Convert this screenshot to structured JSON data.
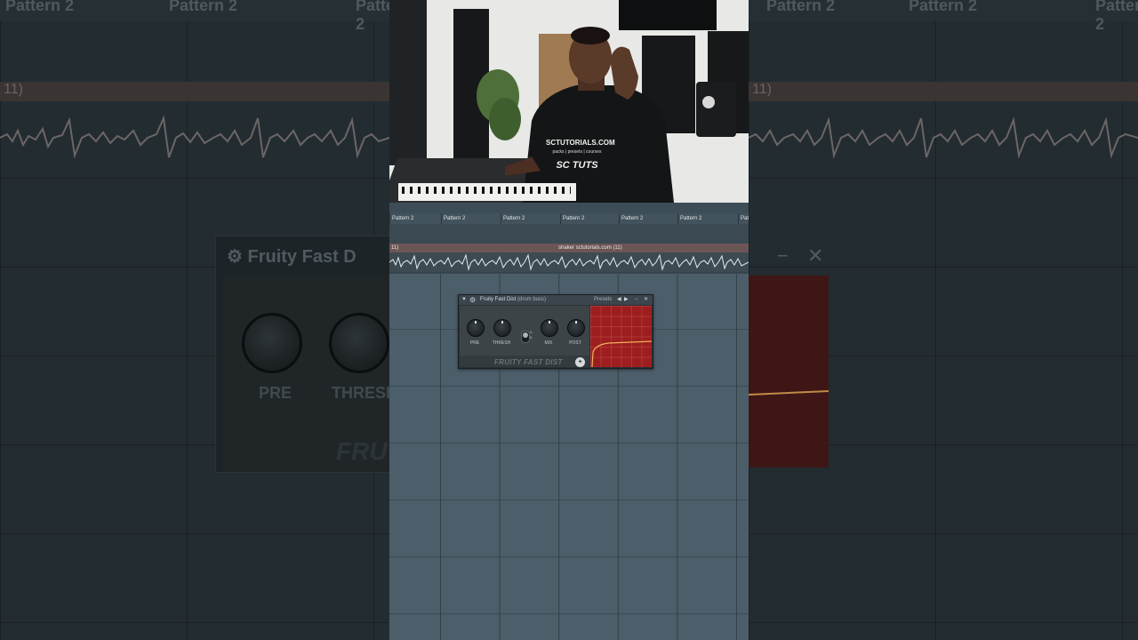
{
  "background": {
    "pattern_label": "Pattern 2",
    "clip_label_fragment": "11)",
    "plugin_title": "Fruity Fast D",
    "knob_labels": [
      "PRE",
      "THRESH"
    ],
    "brand_fragment": "FRU"
  },
  "video": {
    "shirt_line1": "SCTUTORIALS.COM",
    "shirt_line2": "packs | presets | courses",
    "shirt_line3": "SC TUTS"
  },
  "playlist": {
    "patterns": [
      "Pattern 2",
      "Pattern 2",
      "Pattern 2",
      "Pattern 2",
      "Pattern 2",
      "Pattern 2",
      "Patt"
    ],
    "audio_clip": {
      "name": "shaker sctutorials.com (11)",
      "left_fragment": "11)"
    }
  },
  "plugin": {
    "title": "Fruity Fast Dist",
    "subtitle": "(drum buss)",
    "presets_label": "Presets",
    "prev_icon": "◀",
    "next_icon": "▶",
    "minimize_icon": "−",
    "close_icon": "✕",
    "knobs": [
      "PRE",
      "THRESH",
      "MIX",
      "POST"
    ],
    "ab_labels": [
      "A",
      "B"
    ],
    "brand": "FRUITY FAST DIST",
    "accent": "#9d1e1e",
    "curve_color": "#f0b060"
  }
}
